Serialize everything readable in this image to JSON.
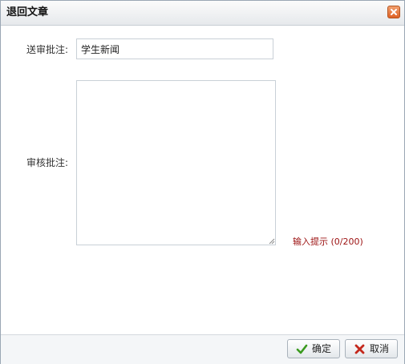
{
  "dialog": {
    "title": "退回文章",
    "close_icon": "close-icon"
  },
  "form": {
    "remark_label": "送审批注:",
    "remark_value": "学生新闻",
    "review_label": "审核批注:",
    "review_value": "",
    "hint": "输入提示 (0/200)"
  },
  "footer": {
    "ok_label": "确定",
    "ok_icon": "check-icon",
    "cancel_label": "取消",
    "cancel_icon": "cross-icon"
  },
  "colors": {
    "hint": "#9b1010",
    "close_button": "#de6226",
    "ok_check": "#3a9a1e",
    "cancel_cross": "#c4281c"
  }
}
